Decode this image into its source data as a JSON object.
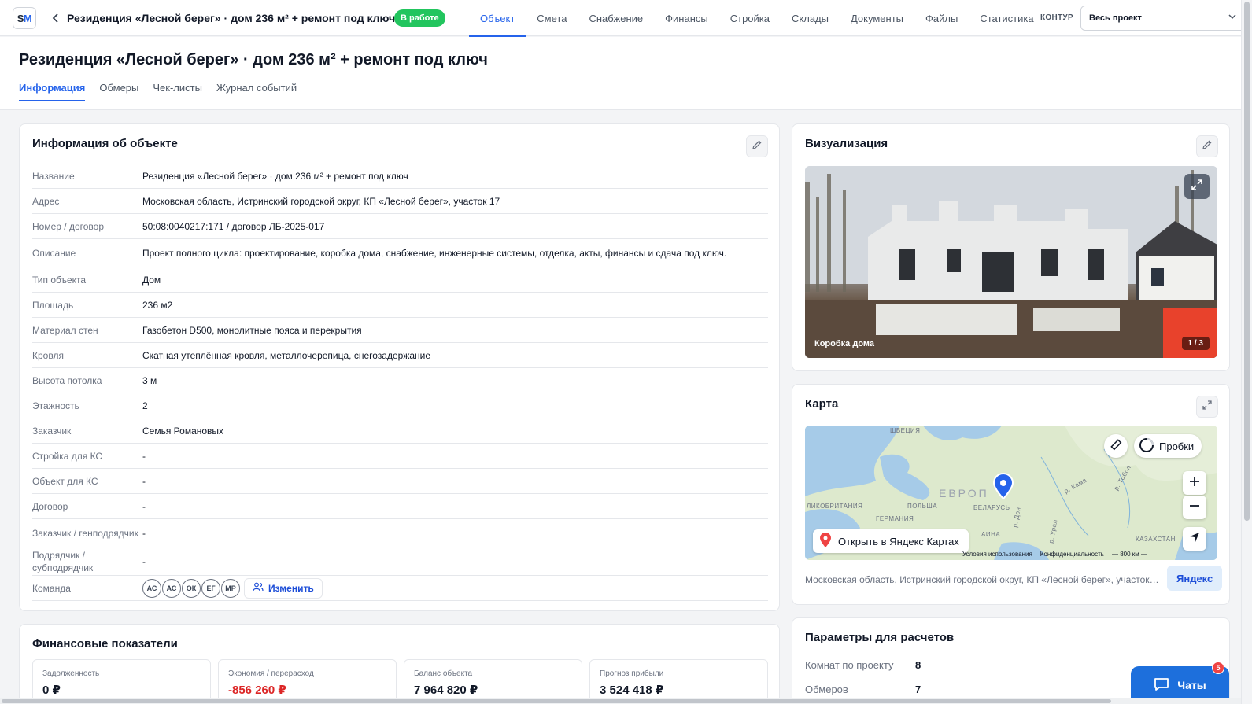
{
  "topbar": {
    "logo": {
      "s": "S",
      "m": "M"
    },
    "project_title": "Резиденция «Лесной берег» · дом 236 м² + ремонт под ключ",
    "status": "В работе",
    "tabs": [
      {
        "label": "Объект",
        "active": true
      },
      {
        "label": "Смета",
        "active": false
      },
      {
        "label": "Снабжение",
        "active": false
      },
      {
        "label": "Финансы",
        "active": false
      },
      {
        "label": "Стройка",
        "active": false
      },
      {
        "label": "Склады",
        "active": false
      },
      {
        "label": "Документы",
        "active": false
      },
      {
        "label": "Файлы",
        "active": false
      },
      {
        "label": "Статистика",
        "active": false
      }
    ],
    "kontur_label": "КОНТУР",
    "scope_value": "Весь проект",
    "colors": {
      "accent": "#2563eb",
      "status": "#22c55e"
    }
  },
  "page": {
    "title": "Резиденция «Лесной берег» · дом 236 м² + ремонт под ключ",
    "tabs": [
      {
        "label": "Информация",
        "active": true
      },
      {
        "label": "Обмеры",
        "active": false
      },
      {
        "label": "Чек-листы",
        "active": false
      },
      {
        "label": "Журнал событий",
        "active": false
      }
    ]
  },
  "info": {
    "title": "Информация об объекте",
    "rows": [
      {
        "label": "Название",
        "value": "Резиденция «Лесной берег» · дом 236 м² + ремонт под ключ"
      },
      {
        "label": "Адрес",
        "value": "Московская область, Истринский городской округ, КП «Лесной берег», участок 17"
      },
      {
        "label": "Номер / договор",
        "value": "50:08:0040217:171 / договор ЛБ-2025-017"
      },
      {
        "label": "Описание",
        "value": "Проект полного цикла: проектирование, коробка дома, снабжение, инженерные системы, отделка, акты, финансы и сдача под ключ."
      },
      {
        "label": "Тип объекта",
        "value": "Дом"
      },
      {
        "label": "Площадь",
        "value": "236 м2"
      },
      {
        "label": "Материал стен",
        "value": "Газобетон D500, монолитные пояса и перекрытия"
      },
      {
        "label": "Кровля",
        "value": "Скатная утеплённая кровля, металлочерепица, снегозадержание"
      },
      {
        "label": "Высота потолка",
        "value": "3 м"
      },
      {
        "label": "Этажность",
        "value": "2"
      },
      {
        "label": "Заказчик",
        "value": "Семья Романовых"
      },
      {
        "label": "Стройка для КС",
        "value": "-"
      },
      {
        "label": "Объект для КС",
        "value": "-"
      },
      {
        "label": "Договор",
        "value": "-"
      },
      {
        "label": "Заказчик / генподрядчик",
        "value": "-"
      },
      {
        "label": "Подрядчик / субподрядчик",
        "value": "-"
      }
    ],
    "team_label": "Команда",
    "team": [
      "АС",
      "АС",
      "ОК",
      "ЕГ",
      "МР"
    ],
    "change_label": "Изменить"
  },
  "finance": {
    "title": "Финансовые показатели",
    "tiles": [
      {
        "label": "Задолженность",
        "value": "0 ₽",
        "negative": false
      },
      {
        "label": "Экономия / перерасход",
        "value": "-856 260 ₽",
        "negative": true
      },
      {
        "label": "Баланс объекта",
        "value": "7 964 820 ₽",
        "negative": false
      },
      {
        "label": "Прогноз прибыли",
        "value": "3 524 418 ₽",
        "negative": false
      }
    ]
  },
  "visual": {
    "title": "Визуализация",
    "caption": "Коробка дома",
    "counter": "1 / 3"
  },
  "map": {
    "title": "Карта",
    "traffic_label": "Пробки",
    "open_label": "Открыть в Яндекс Картах",
    "labels": {
      "europe": "ЕВРОП",
      "sweden": "ШВЕЦИЯ",
      "uk": "ЛИКОБРИТАНИЯ",
      "poland": "ПОЛЬША",
      "belarus": "БЕЛАРУСЬ",
      "germany": "ГЕРМАНИЯ",
      "kazakhstan": "КАЗАХСТАН",
      "kama": "р. Кама",
      "tobol": "р. Тобол",
      "ural": "р. Урал",
      "don": "р. Дон",
      "ukraine": "АИНА"
    },
    "footer_terms": "Условия использования",
    "footer_privacy": "Конфиденциальность",
    "scale": "800 км",
    "address": "Московская область, Истринский городской округ, КП «Лесной берег», участок ...",
    "yandex_label": "Яндекс"
  },
  "params": {
    "title": "Параметры для расчетов",
    "rows": [
      {
        "label": "Комнат по проекту",
        "value": "8"
      },
      {
        "label": "Обмеров",
        "value": "7"
      }
    ]
  },
  "chats": {
    "label": "Чаты",
    "badge": "5"
  }
}
